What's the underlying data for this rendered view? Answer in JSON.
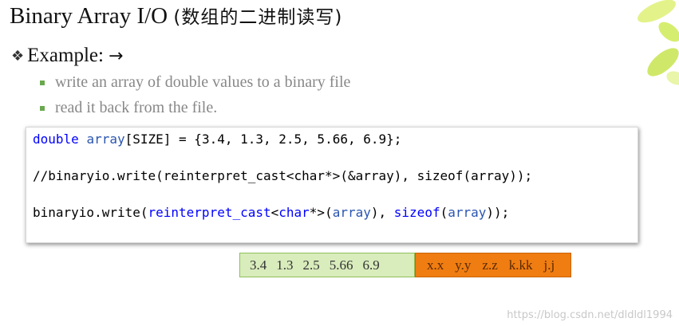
{
  "slide": {
    "title": "Binary Array I/O",
    "title_cn": "(数组的二进制读写)",
    "example_label": "Example:",
    "example_arrow": "→",
    "sub_bullets": [
      "write an array of double values to a binary file",
      "read it back from the file."
    ]
  },
  "code": {
    "line1": {
      "kw": "double",
      "id": "array",
      "rest": "[SIZE] = {3.4, 1.3, 2.5, 5.66, 6.9};"
    },
    "line2": "//binaryio.write(reinterpret_cast<char*>(&array), sizeof(array));",
    "line3": {
      "p1": "binaryio.write(",
      "kw1": "reinterpret_cast",
      "p2": "<",
      "kw2": "char",
      "p3": "*>(",
      "id1": "array",
      "p4": "), ",
      "kw3": "sizeof",
      "p5": "(",
      "id2": "array",
      "p6": "));"
    }
  },
  "memory": {
    "values": [
      "3.4",
      "1.3",
      "2.5",
      "5.66",
      "6.9"
    ],
    "placeholders": [
      "x.x",
      "y.y",
      "z.z",
      "k.kk",
      "j.j"
    ]
  },
  "watermark": "https://blog.csdn.net/dldldl1994",
  "colors": {
    "code_keyword": "#0000ff",
    "code_comment": "#0a8a0a",
    "bullet": "#6aa84f",
    "mem_green": "#d9ecbc",
    "mem_orange": "#f07d12"
  }
}
